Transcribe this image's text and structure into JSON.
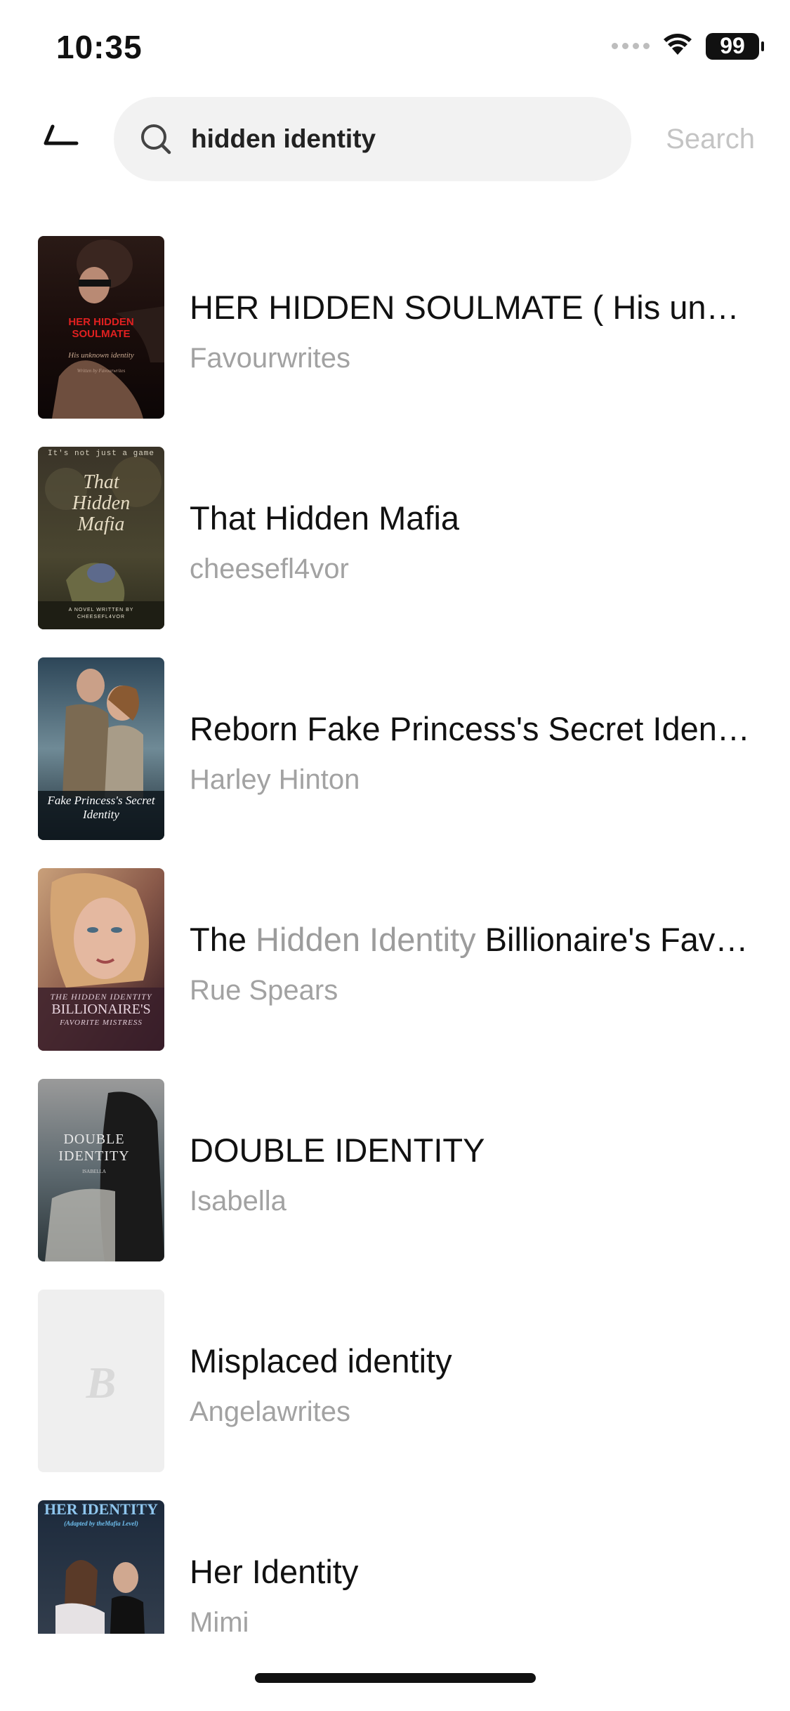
{
  "status_bar": {
    "time": "10:35",
    "battery": "99",
    "icons": [
      "signal-icon",
      "wifi-icon",
      "battery-icon"
    ]
  },
  "search": {
    "back_icon": "back-arrow-icon",
    "query": "hidden identity",
    "search_icon": "search-icon",
    "action_label": "Search"
  },
  "results": [
    {
      "title": "HER HIDDEN SOULMATE ( His unknown identity)",
      "author": "Favourwrites",
      "cover_text": {
        "title": "HER HIDDEN SOULMATE",
        "subtitle": "His unknown identity",
        "byline": "Written by Favourwrites"
      }
    },
    {
      "title": "That Hidden Mafia",
      "author": "cheesefl4vor",
      "cover_text": {
        "tagline": "It's not just a game",
        "title": "That Hidden Mafia",
        "byline": "A NOVEL WRITTEN BY CHEESEFL4VOR"
      }
    },
    {
      "title": "Reborn Fake Princess's Secret Identity",
      "author": "Harley Hinton",
      "cover_text": {
        "title": "Fake Princess's Secret Identity"
      }
    },
    {
      "title_parts": [
        {
          "text": "The ",
          "dim": false
        },
        {
          "text": "Hidden Identity",
          "dim": true
        },
        {
          "text": " Billionaire's Favorite Mistress",
          "dim": false
        }
      ],
      "author": "Rue Spears",
      "cover_text": {
        "line1": "THE HIDDEN IDENTITY",
        "line2": "BILLIONAIRE'S",
        "line3": "FAVORITE MISTRESS"
      }
    },
    {
      "title": "DOUBLE IDENTITY",
      "author": "Isabella",
      "cover_text": {
        "title": "DOUBLE IDENTITY",
        "byline": "ISABELLA"
      }
    },
    {
      "title": "Misplaced identity",
      "author": "Angelawrites",
      "cover_text": {
        "placeholder": "B"
      }
    },
    {
      "title": "Her Identity",
      "author": "Mimi",
      "cover_text": {
        "title": "HER IDENTITY",
        "subtitle": "(Adapted by theMafia Level)"
      }
    }
  ],
  "colors": {
    "background": "#ffffff",
    "search_bg": "#f2f2f2",
    "muted_text": "#a2a2a2",
    "cover1_accent": "#e02020"
  }
}
